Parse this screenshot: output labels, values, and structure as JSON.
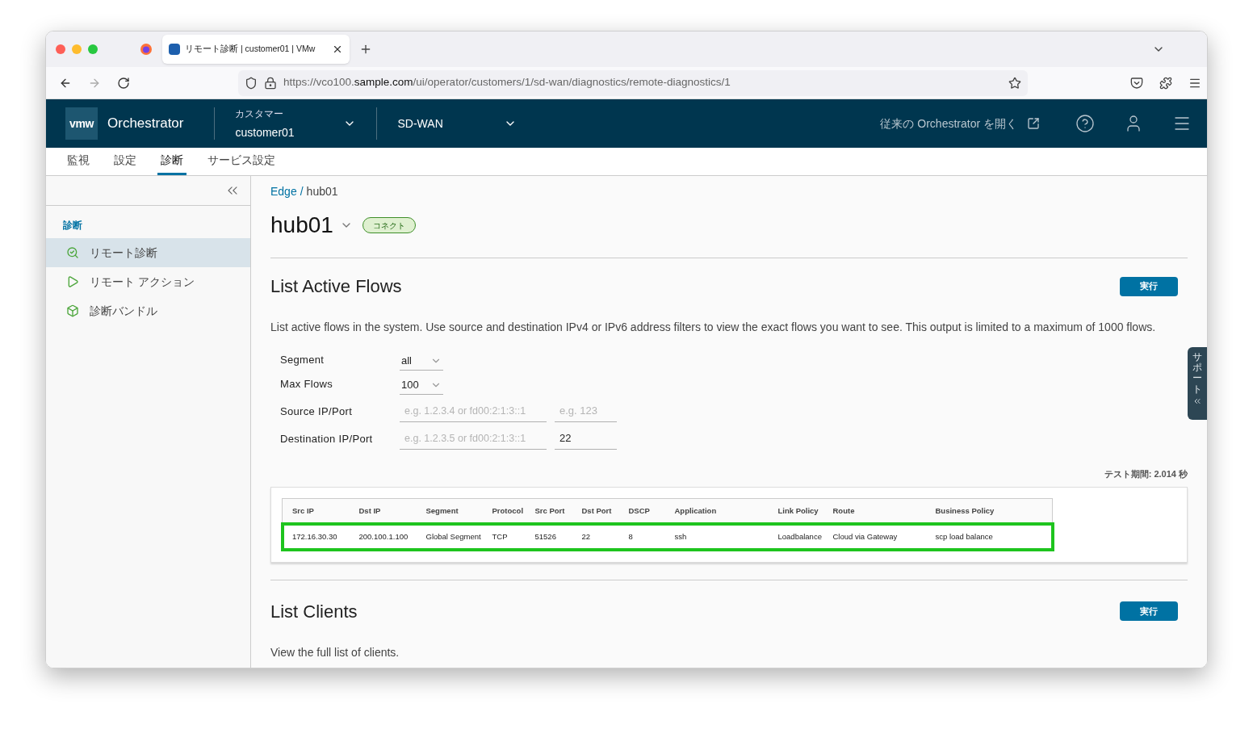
{
  "browser": {
    "tab_title": "リモート診断 | customer01 | VMw",
    "url": {
      "prefix": "https://vco100.",
      "domain": "sample.com",
      "path": "/ui/operator/customers/1/sd-wan/diagnostics/remote-diagnostics/1"
    }
  },
  "header": {
    "logo": "vmw",
    "product": "Orchestrator",
    "customer_label": "カスタマー",
    "customer": "customer01",
    "service": "SD-WAN",
    "legacy_link": "従来の Orchestrator を開く"
  },
  "nav_tabs": [
    {
      "label": "監視",
      "selected": false
    },
    {
      "label": "設定",
      "selected": false
    },
    {
      "label": "診断",
      "selected": true
    },
    {
      "label": "サービス設定",
      "selected": false
    }
  ],
  "sidebar": {
    "section": "診断",
    "items": [
      {
        "label": "リモート診断",
        "kind": "search",
        "selected": true
      },
      {
        "label": "リモート アクション",
        "kind": "play",
        "selected": false
      },
      {
        "label": "診断バンドル",
        "kind": "bundle",
        "selected": false
      }
    ]
  },
  "breadcrumb": {
    "link": "Edge",
    "separator": "/",
    "current": "hub01"
  },
  "title": "hub01",
  "status": "コネクト",
  "active_flows": {
    "title": "List Active Flows",
    "run_button": "実行",
    "description": "List active flows in the system. Use source and destination IPv4 or IPv6 address filters to view the exact flows you want to see. This output is limited to a maximum of 1000 flows.",
    "form": [
      {
        "label": "Segment",
        "kind": "select",
        "value": "all"
      },
      {
        "label": "Max Flows",
        "kind": "select",
        "value": "100"
      },
      {
        "label": "Source IP/Port",
        "kind": "ip-port",
        "ip_placeholder": "e.g. 1.2.3.4 or fd00:2:1:3::1",
        "port_placeholder": "e.g. 123"
      },
      {
        "label": "Destination IP/Port",
        "kind": "ip-port",
        "ip_placeholder": "e.g. 1.2.3.5 or fd00:2:1:3::1",
        "port_value": "22"
      }
    ],
    "test_time": "テスト期間: 2.014 秒",
    "table": {
      "columns": [
        "Src IP",
        "Dst IP",
        "Segment",
        "Protocol",
        "Src Port",
        "Dst Port",
        "DSCP",
        "Application",
        "Link Policy",
        "Route",
        "Business Policy"
      ],
      "rows": [
        {
          "highlighted": true,
          "cells": [
            "172.16.30.30",
            "200.100.1.100",
            "Global Segment",
            "TCP",
            "51526",
            "22",
            "8",
            "ssh",
            "Loadbalance",
            "Cloud via Gateway",
            "scp load balance"
          ]
        }
      ]
    }
  },
  "clients": {
    "title": "List Clients",
    "run_button": "実行",
    "description": "View the full list of clients."
  },
  "support_tab": "サポート"
}
